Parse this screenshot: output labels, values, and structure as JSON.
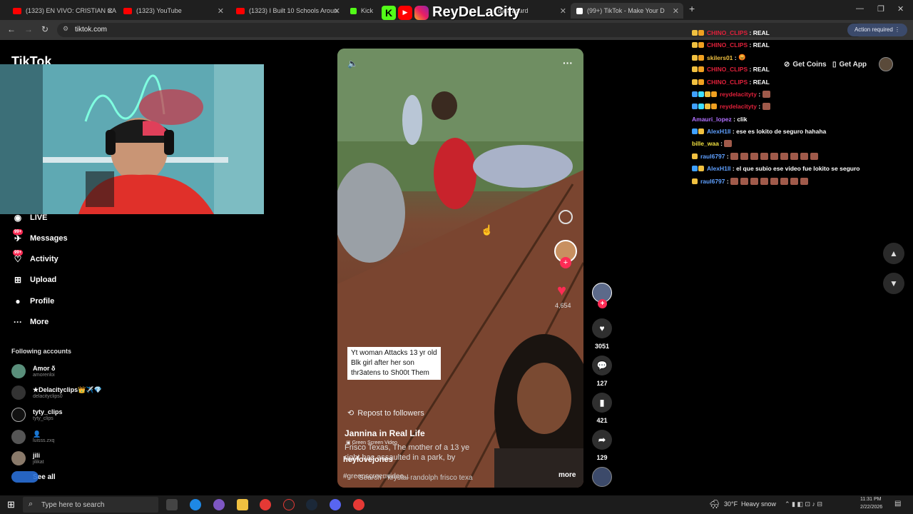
{
  "browser": {
    "tabs": [
      {
        "label": "(1323) EN VIVO: CRISTIAN CA",
        "color": "#ff0000"
      },
      {
        "label": "(1323) YouTube",
        "color": "#ff0000"
      },
      {
        "label": "(1323) I Built 10 Schools Aroun",
        "color": "#ff0000"
      },
      {
        "label": "Kick",
        "color": "#53fc18"
      },
      {
        "label": "dashboard",
        "color": "#53fc18"
      },
      {
        "label": "(99+) TikTok - Make Your D",
        "color": "#ffffff"
      }
    ],
    "url": "tiktok.com",
    "action_required": "Action required"
  },
  "overlay_brand": {
    "name": "ReyDeLaCity"
  },
  "tiktok": {
    "logo_text": "TikTok",
    "nav": [
      {
        "label": "LIVE",
        "icon": "live-icon"
      },
      {
        "label": "Messages",
        "icon": "messages-icon",
        "badge": "99+"
      },
      {
        "label": "Activity",
        "icon": "activity-icon",
        "badge": "99+"
      },
      {
        "label": "Upload",
        "icon": "upload-icon"
      },
      {
        "label": "Profile",
        "icon": "profile-icon"
      },
      {
        "label": "More",
        "icon": "more-icon"
      }
    ],
    "following_title": "Following accounts",
    "accounts": [
      {
        "name": "Amor δ",
        "handle": "amorenloi"
      },
      {
        "name": "★Delacityclips👑✈️💎",
        "handle": "delacityclips0"
      },
      {
        "name": "tyty_clips",
        "handle": "tyty_clips"
      },
      {
        "name": "👤",
        "handle": "luisss.zxq"
      },
      {
        "name": "jili",
        "handle": "jilikat"
      }
    ],
    "see_all": "See all",
    "get_coins": "Get Coins",
    "get_app": "Get App"
  },
  "video": {
    "caption_lines": [
      "Yt woman Attacks 13 yr old",
      "Blk girl after her son",
      "thr3atens to Sh00t Them"
    ],
    "like_overlay": "4,654",
    "repost": "Repost to followers",
    "creator_title": "Jannina in Real Life",
    "green_screen": "Green Screen Video",
    "desc1": "Frisco Texas, The mother of a 13 ye",
    "desc2": "right has assaulted in a park, by",
    "author": "heylovejones",
    "hashtag": "#greenscreenvideo...",
    "search": "Search · krystal randolph frisco texa",
    "more": "more"
  },
  "actions": {
    "likes": "3051",
    "comments": "127",
    "saves": "421",
    "shares": "129"
  },
  "chat": [
    {
      "user": "CHINO_CLIPS",
      "color": "#e0203a",
      "msg": "REAL"
    },
    {
      "user": "CHINO_CLIPS",
      "color": "#e0203a",
      "msg": "REAL"
    },
    {
      "user": "skilers01",
      "color": "#f0c040",
      "msg": "😡"
    },
    {
      "user": "CHINO_CLIPS",
      "color": "#e0203a",
      "msg": "REAL"
    },
    {
      "user": "CHINO_CLIPS",
      "color": "#e0203a",
      "msg": "REAL"
    },
    {
      "user": "reydelacityty",
      "color": "#e0203a",
      "msg": ""
    },
    {
      "user": "reydelacityty",
      "color": "#e0203a",
      "msg": ""
    },
    {
      "user": "Amauri_lopez",
      "color": "#b070ff",
      "msg": "clik"
    },
    {
      "user": "AlexH1ll",
      "color": "#5fa0ff",
      "msg": "ese es lokito de seguro hahaha"
    },
    {
      "user": "bille_waa",
      "color": "#f0e040",
      "msg": ""
    },
    {
      "user": "raul6797",
      "color": "#5fa0ff",
      "msg": ""
    },
    {
      "user": "AlexH1ll",
      "color": "#5fa0ff",
      "msg": "el que subio ese video fue lokito se seguro"
    },
    {
      "user": "raul6797",
      "color": "#5fa0ff",
      "msg": ""
    }
  ],
  "taskbar": {
    "search_placeholder": "Type here to search",
    "weather_temp": "30°F",
    "weather_desc": "Heavy snow",
    "time": "11:31 PM",
    "date": "2/22/2026"
  }
}
